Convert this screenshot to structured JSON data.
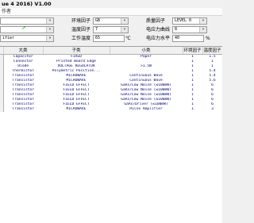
{
  "window": {
    "title": "ue 4 2016)  V1.00"
  },
  "menu": {
    "item": "作者"
  },
  "params": {
    "field1": {
      "label": "环境因子",
      "value": "GB"
    },
    "field2": {
      "label": "质量因子",
      "value": "LEVEL 0"
    },
    "field3": {
      "label": "温度因子",
      "value": "7"
    },
    "field4": {
      "label": "电应力曲线",
      "value": "8"
    },
    "field5": {
      "label": "工作温度",
      "value": "65",
      "unit": "℃"
    },
    "field6": {
      "label": "电应力水平",
      "value": "40",
      "unit": "%"
    },
    "left_combo_last": "ifier"
  },
  "table": {
    "headers": [
      "",
      "大类",
      "子类",
      "小类",
      "环境因子",
      "温度因子"
    ],
    "rows": [
      [
        "Capacitor",
        "FIXED",
        "Paper",
        "1",
        "1.5"
      ],
      [
        "Connector",
        "Printed Board Edge",
        "",
        "1",
        "1"
      ],
      [
        "Diode",
        "VOLTAGE REGULATOR",
        ">1.5W",
        "1",
        "1"
      ],
      [
        "Thermistor",
        "Polymetric Positive...",
        "",
        "1",
        "5.4"
      ],
      [
        "Transistor",
        "MICROWAVE",
        "Continuous Wave",
        "1",
        "5.4"
      ],
      [
        "Transistor",
        "MICROWAVE",
        "Continuous Wave",
        "1",
        "5.6"
      ],
      [
        "Transistor",
        "FIELD EFFECT",
        "GaAs/Low Noise (≤100mW)",
        "1",
        "6"
      ],
      [
        "Transistor",
        "FIELD EFFECT",
        "GaAs/Low Noise (≤100mW)",
        "1",
        "6"
      ],
      [
        "Transistor",
        "FIELD EFFECT",
        "GaAs/Low Noise (≤100mW)",
        "1",
        "6"
      ],
      [
        "Transistor",
        "FIELD EFFECT",
        "GaAs/Low Noise (≤100mW)",
        "1",
        "6"
      ],
      [
        "Transistor",
        "FIELD EFFECT",
        "GaAs/Driver (≤100mW)",
        "1",
        "6"
      ],
      [
        "Transistor",
        "MICROWAVE",
        "Pulse Amplifier",
        "1",
        "3"
      ]
    ]
  }
}
